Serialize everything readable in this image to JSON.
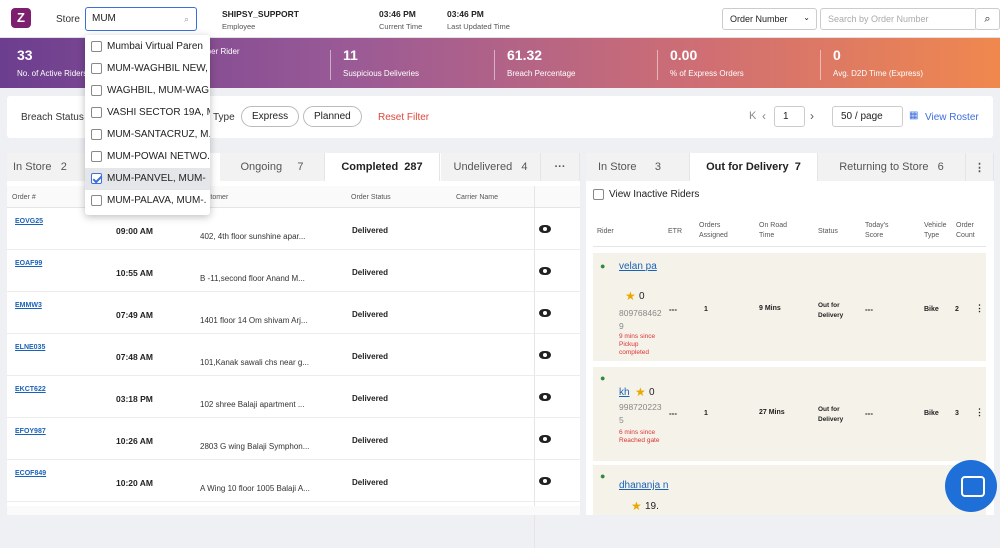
{
  "header": {
    "logo": "Z",
    "store_label": "Store",
    "store_search": "MUM",
    "user_name": "SHIPSY_SUPPORT",
    "user_role": "Employee",
    "current_time": "03:46 PM",
    "current_time_label": "Current Time",
    "last_updated": "03:46 PM",
    "last_updated_label": "Last Updated Time",
    "search_type": "Order Number",
    "search_placeholder": "Search by Order Number"
  },
  "stats": [
    {
      "value": "33",
      "label": "No. of Active Riders"
    },
    {
      "value": "",
      "label": "Orders per Rider"
    },
    {
      "value": "11",
      "label": "Suspicious Deliveries"
    },
    {
      "value": "61.32",
      "label": "Breach Percentage"
    },
    {
      "value": "0.00",
      "label": "% of Express Orders"
    },
    {
      "value": "0",
      "label": "Avg. D2D Time (Express)"
    }
  ],
  "filters": {
    "breach_label": "Breach Status",
    "type_label": "Type",
    "express": "Express",
    "planned": "Planned",
    "reset": "Reset Filter",
    "page": "1",
    "page_size": "50 / page",
    "view_roster": "View Roster"
  },
  "left_tabs": [
    {
      "label": "In Store",
      "count": "2"
    },
    {
      "label": "Ongoing",
      "count": "7"
    },
    {
      "label": "Completed",
      "count": "287"
    },
    {
      "label": "Undelivered",
      "count": "4"
    }
  ],
  "left_columns": {
    "order": "Order #",
    "customer": "ustomer",
    "status": "Order Status",
    "carrier": "Carrier Name"
  },
  "orders": [
    {
      "id": "EOVG25",
      "time": "09:00 AM",
      "address": "402, 4th floor sunshine apar...",
      "status": "Delivered"
    },
    {
      "id": "EOAF99",
      "time": "10:55 AM",
      "address": "B -11,second floor Anand M...",
      "status": "Delivered"
    },
    {
      "id": "EMMW3",
      "time": "07:49 AM",
      "address": "1401 floor 14 Om shivam Arj...",
      "status": "Delivered"
    },
    {
      "id": "ELNE035",
      "time": "07:48 AM",
      "address": "101,Kanak sawali chs near g...",
      "status": "Delivered"
    },
    {
      "id": "EKCT622",
      "time": "03:18 PM",
      "address": "102 shree Balaji apartment ...",
      "status": "Delivered"
    },
    {
      "id": "EFOY987",
      "time": "10:26 AM",
      "address": "2803 G wing Balaji Symphon...",
      "status": "Delivered"
    },
    {
      "id": "ECOF849",
      "time": "10:20 AM",
      "address": "A Wing 10 floor 1005 Balaji A...",
      "status": "Delivered"
    }
  ],
  "right_tabs": [
    {
      "label": "In Store",
      "count": "3"
    },
    {
      "label": "Out for Delivery",
      "count": "7"
    },
    {
      "label": "Returning to Store",
      "count": "6"
    }
  ],
  "inactive_label": "View Inactive Riders",
  "right_columns": {
    "rider": "Rider",
    "etr": "ETR",
    "orders": "Orders Assigned",
    "road": "On Road Time",
    "status": "Status",
    "score": "Today's Score",
    "vehicle": "Vehicle Type",
    "count": "Order Count"
  },
  "riders": [
    {
      "name": "velan pa",
      "rating": "0",
      "phone": "8097684629",
      "since": "9 mins since",
      "event": "Pickup completed",
      "etr": "---",
      "orders": "1",
      "road": "9 Mins",
      "status": "Out for Delivery",
      "score": "---",
      "vehicle": "Bike",
      "count": "2"
    },
    {
      "name": "kh",
      "rating": "0",
      "phone": "9987202235",
      "since": "6 mins since",
      "event": "Reached gate",
      "etr": "---",
      "orders": "1",
      "road": "27 Mins",
      "status": "Out for Delivery",
      "score": "---",
      "vehicle": "Bike",
      "count": "3"
    },
    {
      "name": "dhananja n",
      "rating": "19."
    }
  ],
  "dropdown": [
    {
      "label": "Mumbai Virtual Paren",
      "checked": false
    },
    {
      "label": "MUM-WAGHBIL NEW,",
      "checked": false
    },
    {
      "label": "WAGHBIL, MUM-WAG",
      "checked": false
    },
    {
      "label": "VASHI SECTOR 19A, M",
      "checked": false
    },
    {
      "label": "MUM-SANTACRUZ, M.",
      "checked": false
    },
    {
      "label": "MUM-POWAI NETWO.",
      "checked": false
    },
    {
      "label": "MUM-PANVEL, MUM-",
      "checked": true
    },
    {
      "label": "MUM-PALAVA, MUM-.",
      "checked": false
    }
  ],
  "colors": {
    "accent": "#3d6fdc",
    "brand": "#7d1f6e",
    "link": "#1a62b8",
    "reset": "#e0463a"
  }
}
